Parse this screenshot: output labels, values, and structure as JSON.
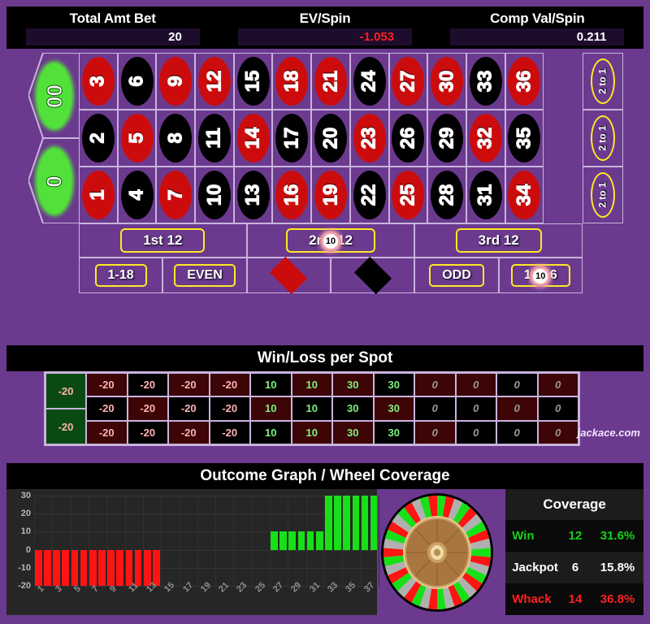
{
  "header": {
    "stats": [
      {
        "title": "Total Amt Bet",
        "value": "20",
        "negative": false
      },
      {
        "title": "EV/Spin",
        "value": "-1.053",
        "negative": true
      },
      {
        "title": "Comp Val/Spin",
        "value": "0.211",
        "negative": false
      }
    ]
  },
  "table": {
    "zeros": [
      {
        "label": "00"
      },
      {
        "label": "0"
      }
    ],
    "rows": [
      {
        "cells": [
          {
            "n": "3",
            "color": "red"
          },
          {
            "n": "6",
            "color": "black"
          },
          {
            "n": "9",
            "color": "red"
          },
          {
            "n": "12",
            "color": "red"
          },
          {
            "n": "15",
            "color": "black"
          },
          {
            "n": "18",
            "color": "red"
          },
          {
            "n": "21",
            "color": "red"
          },
          {
            "n": "24",
            "color": "black"
          },
          {
            "n": "27",
            "color": "red"
          },
          {
            "n": "30",
            "color": "red"
          },
          {
            "n": "33",
            "color": "black"
          },
          {
            "n": "36",
            "color": "red"
          }
        ]
      },
      {
        "cells": [
          {
            "n": "2",
            "color": "black"
          },
          {
            "n": "5",
            "color": "red"
          },
          {
            "n": "8",
            "color": "black"
          },
          {
            "n": "11",
            "color": "black"
          },
          {
            "n": "14",
            "color": "red"
          },
          {
            "n": "17",
            "color": "black"
          },
          {
            "n": "20",
            "color": "black"
          },
          {
            "n": "23",
            "color": "red"
          },
          {
            "n": "26",
            "color": "black"
          },
          {
            "n": "29",
            "color": "black"
          },
          {
            "n": "32",
            "color": "red"
          },
          {
            "n": "35",
            "color": "black"
          }
        ]
      },
      {
        "cells": [
          {
            "n": "1",
            "color": "red"
          },
          {
            "n": "4",
            "color": "black"
          },
          {
            "n": "7",
            "color": "red"
          },
          {
            "n": "10",
            "color": "black"
          },
          {
            "n": "13",
            "color": "black"
          },
          {
            "n": "16",
            "color": "red"
          },
          {
            "n": "19",
            "color": "red"
          },
          {
            "n": "22",
            "color": "black"
          },
          {
            "n": "25",
            "color": "red"
          },
          {
            "n": "28",
            "color": "black"
          },
          {
            "n": "31",
            "color": "black"
          },
          {
            "n": "34",
            "color": "red"
          }
        ]
      }
    ],
    "column_bets": [
      "2 to 1",
      "2 to 1",
      "2 to 1"
    ],
    "dozens": [
      "1st 12",
      "2nd 12",
      "3rd 12"
    ],
    "outside": [
      {
        "kind": "text",
        "label": "1-18"
      },
      {
        "kind": "text",
        "label": "EVEN"
      },
      {
        "kind": "diamond",
        "label": "RED",
        "color": "red"
      },
      {
        "kind": "diamond",
        "label": "BLACK",
        "color": "black"
      },
      {
        "kind": "text",
        "label": "ODD"
      },
      {
        "kind": "text",
        "label": "19-36"
      }
    ],
    "chips": [
      {
        "value": "10",
        "on": "2nd 12"
      },
      {
        "value": "10",
        "on": "19-36"
      }
    ]
  },
  "winloss": {
    "title": "Win/Loss per Spot",
    "zeros": [
      {
        "value": "-20"
      },
      {
        "value": "-20"
      }
    ],
    "rows": [
      {
        "cells": [
          {
            "v": "-20",
            "color": "red",
            "state": "loss"
          },
          {
            "v": "-20",
            "color": "black",
            "state": "loss"
          },
          {
            "v": "-20",
            "color": "red",
            "state": "loss"
          },
          {
            "v": "-20",
            "color": "red",
            "state": "loss"
          },
          {
            "v": "10",
            "color": "black",
            "state": "win"
          },
          {
            "v": "10",
            "color": "red",
            "state": "win"
          },
          {
            "v": "30",
            "color": "red",
            "state": "win"
          },
          {
            "v": "30",
            "color": "black",
            "state": "win"
          },
          {
            "v": "0",
            "color": "red",
            "state": "zeroval"
          },
          {
            "v": "0",
            "color": "red",
            "state": "zeroval"
          },
          {
            "v": "0",
            "color": "black",
            "state": "zeroval"
          },
          {
            "v": "0",
            "color": "red",
            "state": "zeroval"
          }
        ]
      },
      {
        "cells": [
          {
            "v": "-20",
            "color": "black",
            "state": "loss"
          },
          {
            "v": "-20",
            "color": "red",
            "state": "loss"
          },
          {
            "v": "-20",
            "color": "black",
            "state": "loss"
          },
          {
            "v": "-20",
            "color": "black",
            "state": "loss"
          },
          {
            "v": "10",
            "color": "red",
            "state": "win"
          },
          {
            "v": "10",
            "color": "black",
            "state": "win"
          },
          {
            "v": "30",
            "color": "black",
            "state": "win"
          },
          {
            "v": "30",
            "color": "red",
            "state": "win"
          },
          {
            "v": "0",
            "color": "black",
            "state": "zeroval"
          },
          {
            "v": "0",
            "color": "black",
            "state": "zeroval"
          },
          {
            "v": "0",
            "color": "red",
            "state": "zeroval"
          },
          {
            "v": "0",
            "color": "black",
            "state": "zeroval"
          }
        ]
      },
      {
        "cells": [
          {
            "v": "-20",
            "color": "red",
            "state": "loss"
          },
          {
            "v": "-20",
            "color": "black",
            "state": "loss"
          },
          {
            "v": "-20",
            "color": "red",
            "state": "loss"
          },
          {
            "v": "-20",
            "color": "black",
            "state": "loss"
          },
          {
            "v": "10",
            "color": "black",
            "state": "win"
          },
          {
            "v": "10",
            "color": "red",
            "state": "win"
          },
          {
            "v": "30",
            "color": "red",
            "state": "win"
          },
          {
            "v": "30",
            "color": "black",
            "state": "win"
          },
          {
            "v": "0",
            "color": "red",
            "state": "zeroval"
          },
          {
            "v": "0",
            "color": "black",
            "state": "zeroval"
          },
          {
            "v": "0",
            "color": "black",
            "state": "zeroval"
          },
          {
            "v": "0",
            "color": "red",
            "state": "zeroval"
          }
        ]
      }
    ],
    "brand": "jackace.com"
  },
  "outcome": {
    "title": "Outcome Graph / Wheel Coverage",
    "coverage": {
      "title": "Coverage",
      "rows": [
        {
          "label": "Win",
          "count": "12",
          "pct": "31.6%",
          "style": "c-win"
        },
        {
          "label": "Jackpot",
          "count": "6",
          "pct": "15.8%",
          "style": "c-jack"
        },
        {
          "label": "Whack",
          "count": "14",
          "pct": "36.8%",
          "style": "c-whack"
        }
      ]
    }
  },
  "chart_data": {
    "type": "bar",
    "title": "Outcome Graph / Wheel Coverage",
    "xlabel": "",
    "ylabel": "",
    "ylim": [
      -20,
      30
    ],
    "yticks": [
      30,
      20,
      10,
      0,
      -10,
      -20
    ],
    "grid": true,
    "legend": "none",
    "x": [
      1,
      2,
      3,
      4,
      5,
      6,
      7,
      8,
      9,
      10,
      11,
      12,
      13,
      14,
      15,
      16,
      17,
      18,
      19,
      20,
      21,
      22,
      23,
      24,
      25,
      26,
      27,
      28,
      29,
      30,
      31,
      32,
      33,
      34,
      35,
      36,
      37,
      38
    ],
    "xtick_labels": [
      "1",
      "3",
      "5",
      "7",
      "9",
      "11",
      "13",
      "15",
      "17",
      "19",
      "21",
      "23",
      "25",
      "27",
      "29",
      "31",
      "33",
      "35",
      "37"
    ],
    "values": [
      -20,
      -20,
      -20,
      -20,
      -20,
      -20,
      -20,
      -20,
      -20,
      -20,
      -20,
      -20,
      -20,
      -20,
      0,
      0,
      0,
      0,
      0,
      0,
      0,
      0,
      0,
      0,
      0,
      0,
      10,
      10,
      10,
      10,
      10,
      10,
      30,
      30,
      30,
      30,
      30,
      30
    ],
    "colors": {
      "positive": "#18e018",
      "negative": "#ff1414",
      "background": "#262626"
    }
  }
}
